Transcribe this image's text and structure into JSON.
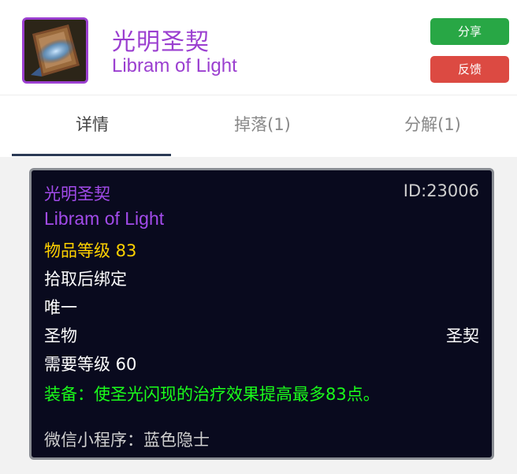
{
  "item": {
    "name_cn": "光明圣契",
    "name_en": "Libram of Light",
    "icon": "libram-book-icon",
    "quality_color": "#a24bea"
  },
  "actions": {
    "share_label": "分享",
    "feedback_label": "反馈",
    "share_color": "#28a745",
    "feedback_color": "#dc4a42"
  },
  "tabs": [
    {
      "label": "详情",
      "active": true
    },
    {
      "label": "掉落(1)",
      "active": false
    },
    {
      "label": "分解(1)",
      "active": false
    }
  ],
  "tooltip": {
    "name_cn": "光明圣契",
    "id_text": "ID:23006",
    "name_en": "Libram of Light",
    "item_level": "物品等级 83",
    "bind": "拾取后绑定",
    "unique": "唯一",
    "slot": "圣物",
    "type": "圣契",
    "required_level": "需要等级 60",
    "equip_effect": "装备：使圣光闪现的治疗效果提高最多83点。",
    "footer": "微信小程序：蓝色隐士"
  }
}
